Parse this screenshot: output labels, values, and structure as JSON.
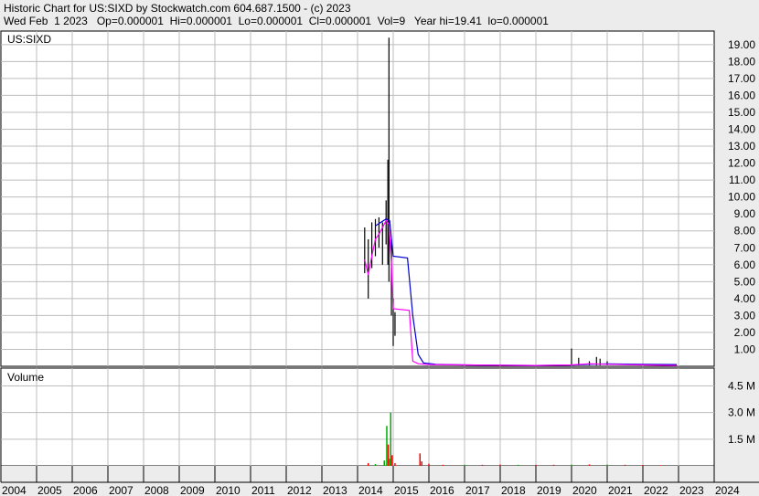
{
  "header": {
    "line1": "Historic Chart for US:SIXD by Stockwatch.com 604.687.1500 - (c) 2023",
    "line2": "Wed Feb  1 2023   Op=0.000001  Hi=0.000001  Lo=0.000001  Cl=0.000001  Vol=9   Year hi=19.41  lo=0.000001"
  },
  "chart_data": [
    {
      "type": "line",
      "label": "US:SIXD",
      "ylim": [
        0,
        19.8
      ],
      "yticks": [
        "1.00",
        "2.00",
        "3.00",
        "4.00",
        "5.00",
        "6.00",
        "7.00",
        "8.00",
        "9.00",
        "10.00",
        "11.00",
        "12.00",
        "13.00",
        "14.00",
        "15.00",
        "16.00",
        "17.00",
        "18.00",
        "19.00"
      ],
      "x_years": [
        "2004",
        "2005",
        "2006",
        "2007",
        "2008",
        "2009",
        "2010",
        "2011",
        "2012",
        "2013",
        "2014",
        "2015",
        "2016",
        "2017",
        "2018",
        "2019",
        "2020",
        "2021",
        "2022",
        "2023",
        "2024"
      ],
      "colors": {
        "price": "#000000",
        "ma_short": "#ff00ff",
        "ma_long": "#0000cc",
        "grid": "#bdbdbd"
      },
      "price_bars": [
        {
          "x": 2014.2,
          "lo": 5.5,
          "hi": 8.2
        },
        {
          "x": 2014.3,
          "lo": 4.0,
          "hi": 7.5
        },
        {
          "x": 2014.4,
          "lo": 5.8,
          "hi": 8.5
        },
        {
          "x": 2014.5,
          "lo": 6.5,
          "hi": 8.7
        },
        {
          "x": 2014.6,
          "lo": 7.0,
          "hi": 8.8
        },
        {
          "x": 2014.7,
          "lo": 6.0,
          "hi": 8.5
        },
        {
          "x": 2014.8,
          "lo": 7.2,
          "hi": 9.8
        },
        {
          "x": 2014.85,
          "lo": 6.0,
          "hi": 12.2
        },
        {
          "x": 2014.88,
          "lo": 5.0,
          "hi": 19.41
        },
        {
          "x": 2014.95,
          "lo": 3.0,
          "hi": 7.5
        },
        {
          "x": 2015.0,
          "lo": 1.2,
          "hi": 4.0
        },
        {
          "x": 2015.05,
          "lo": 1.8,
          "hi": 3.2
        },
        {
          "x": 2020.0,
          "lo": 0.05,
          "hi": 1.05
        },
        {
          "x": 2020.2,
          "lo": 0.05,
          "hi": 0.5
        },
        {
          "x": 2020.5,
          "lo": 0.05,
          "hi": 0.3
        },
        {
          "x": 2020.7,
          "lo": 0.05,
          "hi": 0.55
        },
        {
          "x": 2020.8,
          "lo": 0.05,
          "hi": 0.45
        },
        {
          "x": 2021.0,
          "lo": 0.05,
          "hi": 0.3
        }
      ],
      "ma_short": [
        [
          2014.2,
          6.3
        ],
        [
          2014.3,
          5.4
        ],
        [
          2014.4,
          6.5
        ],
        [
          2014.5,
          7.5
        ],
        [
          2014.6,
          7.8
        ],
        [
          2014.7,
          8.2
        ],
        [
          2014.8,
          8.6
        ],
        [
          2014.88,
          8.4
        ],
        [
          2014.95,
          6.0
        ],
        [
          2015.0,
          3.4
        ],
        [
          2015.45,
          3.3
        ],
        [
          2015.55,
          0.3
        ],
        [
          2015.7,
          0.15
        ],
        [
          2016.0,
          0.1
        ],
        [
          2017.0,
          0.08
        ],
        [
          2018.0,
          0.06
        ],
        [
          2019.0,
          0.05
        ],
        [
          2020.0,
          0.08
        ],
        [
          2020.5,
          0.15
        ],
        [
          2021.0,
          0.12
        ],
        [
          2022.0,
          0.08
        ],
        [
          2022.95,
          0.05
        ]
      ],
      "ma_long": [
        [
          2014.5,
          8.3
        ],
        [
          2014.8,
          8.7
        ],
        [
          2014.9,
          8.6
        ],
        [
          2015.0,
          6.5
        ],
        [
          2015.4,
          6.4
        ],
        [
          2015.55,
          3.0
        ],
        [
          2015.7,
          0.7
        ],
        [
          2015.85,
          0.2
        ],
        [
          2016.2,
          0.12
        ],
        [
          2017.0,
          0.08
        ],
        [
          2018.0,
          0.06
        ],
        [
          2019.0,
          0.05
        ],
        [
          2020.0,
          0.07
        ],
        [
          2020.5,
          0.12
        ],
        [
          2021.0,
          0.14
        ],
        [
          2022.0,
          0.12
        ],
        [
          2022.95,
          0.1
        ]
      ]
    },
    {
      "type": "bar",
      "label": "Volume",
      "ylim": [
        0,
        5500000
      ],
      "yticks": [
        "1.5 M",
        "3.0 M",
        "4.5 M"
      ],
      "ytick_values": [
        1500000,
        3000000,
        4500000
      ],
      "colors": {
        "up": "#00aa00",
        "down": "#ff0000"
      },
      "bars": [
        {
          "x": 2014.3,
          "v": 150000,
          "c": "down"
        },
        {
          "x": 2014.5,
          "v": 100000,
          "c": "up"
        },
        {
          "x": 2014.75,
          "v": 300000,
          "c": "up"
        },
        {
          "x": 2014.82,
          "v": 2250000,
          "c": "up"
        },
        {
          "x": 2014.86,
          "v": 1200000,
          "c": "down"
        },
        {
          "x": 2014.9,
          "v": 400000,
          "c": "up"
        },
        {
          "x": 2014.93,
          "v": 3000000,
          "c": "up"
        },
        {
          "x": 2014.97,
          "v": 600000,
          "c": "down"
        },
        {
          "x": 2015.05,
          "v": 150000,
          "c": "down"
        },
        {
          "x": 2015.75,
          "v": 700000,
          "c": "down"
        },
        {
          "x": 2015.8,
          "v": 250000,
          "c": "down"
        },
        {
          "x": 2016.0,
          "v": 120000,
          "c": "down"
        },
        {
          "x": 2016.4,
          "v": 60000,
          "c": "down"
        },
        {
          "x": 2017.0,
          "v": 60000,
          "c": "up"
        },
        {
          "x": 2017.5,
          "v": 60000,
          "c": "down"
        },
        {
          "x": 2018.0,
          "v": 70000,
          "c": "down"
        },
        {
          "x": 2018.5,
          "v": 60000,
          "c": "up"
        },
        {
          "x": 2019.0,
          "v": 60000,
          "c": "down"
        },
        {
          "x": 2019.5,
          "v": 60000,
          "c": "down"
        },
        {
          "x": 2020.0,
          "v": 70000,
          "c": "up"
        },
        {
          "x": 2020.5,
          "v": 80000,
          "c": "down"
        },
        {
          "x": 2021.0,
          "v": 70000,
          "c": "up"
        },
        {
          "x": 2021.5,
          "v": 60000,
          "c": "down"
        },
        {
          "x": 2022.0,
          "v": 50000,
          "c": "down"
        },
        {
          "x": 2022.5,
          "v": 40000,
          "c": "down"
        }
      ]
    }
  ]
}
